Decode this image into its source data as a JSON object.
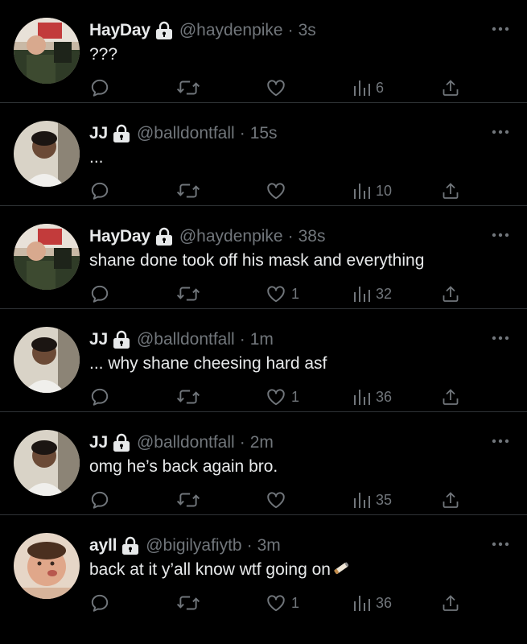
{
  "tweets": [
    {
      "name": "HayDay",
      "handle": "@haydenpike",
      "time": "3s",
      "text": "???",
      "likes": "",
      "views": "6"
    },
    {
      "name": "JJ",
      "handle": "@balldontfall",
      "time": "15s",
      "text": "...",
      "likes": "",
      "views": "10"
    },
    {
      "name": "HayDay",
      "handle": "@haydenpike",
      "time": "38s",
      "text": "shane done took off his mask and everything",
      "likes": "1",
      "views": "32"
    },
    {
      "name": "JJ",
      "handle": "@balldontfall",
      "time": "1m",
      "text": "... why shane cheesing hard asf",
      "likes": "1",
      "views": "36"
    },
    {
      "name": "JJ",
      "handle": "@balldontfall",
      "time": "2m",
      "text": "omg he’s back again bro.",
      "likes": "",
      "views": "35"
    },
    {
      "name": "ayll",
      "handle": "@bigilyafiytb",
      "time": "3m",
      "text": "back at it y’all know wtf going on",
      "likes": "1",
      "views": "36"
    }
  ],
  "separator": "·",
  "icons": {
    "reply": "reply-icon",
    "retweet": "retweet-icon",
    "like": "heart-icon",
    "views": "views-icon",
    "share": "share-icon",
    "lock": "lock-icon",
    "more": "more-icon"
  },
  "colors": {
    "background": "#000000",
    "text": "#e7e9ea",
    "muted": "#71767b",
    "divider": "#2f3336"
  }
}
